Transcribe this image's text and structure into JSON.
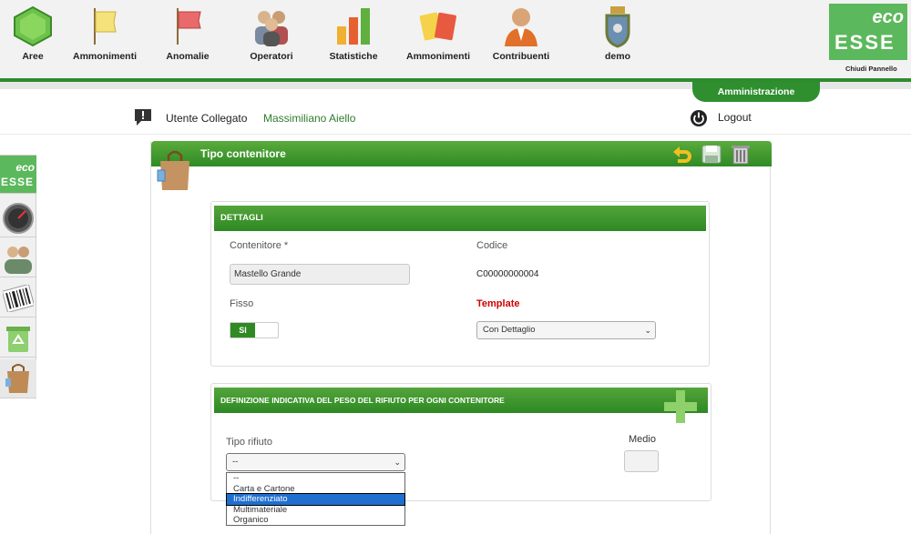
{
  "nav": [
    {
      "label": "Aree",
      "icon": "hexagon-icon"
    },
    {
      "label": "Ammonimenti",
      "icon": "yellow-flag-icon"
    },
    {
      "label": "Anomalie",
      "icon": "red-flag-icon"
    },
    {
      "label": "Operatori",
      "icon": "operators-icon"
    },
    {
      "label": "Statistiche",
      "icon": "bar-chart-icon"
    },
    {
      "label": "Ammonimenti",
      "icon": "cards-icon"
    },
    {
      "label": "Contribuenti",
      "icon": "user-icon"
    },
    {
      "label": "demo",
      "icon": "coat-of-arms-icon"
    }
  ],
  "logo": {
    "line1": "eco",
    "line2": "ESSE",
    "close_label": "Chiudi Pannello"
  },
  "admin_tab": "Amministrazione",
  "user": {
    "label": "Utente Collegato",
    "name": "Massimiliano Aiello",
    "logout": "Logout"
  },
  "page": {
    "title": "Tipo contenitore"
  },
  "details": {
    "header": "DETTAGLI",
    "contenitore_label": "Contenitore *",
    "contenitore_value": "Mastello Grande",
    "codice_label": "Codice",
    "codice_value": "C00000000004",
    "fisso_label": "Fisso",
    "fisso_value": "SI",
    "template_label": "Template",
    "template_value": "Con Dettaglio"
  },
  "weights": {
    "header": "DEFINIZIONE INDICATIVA DEL PESO DEL RIFIUTO PER OGNI CONTENITORE",
    "tipo_label": "Tipo rifiuto",
    "tipo_value": "--",
    "medio_label": "Medio",
    "options": [
      "--",
      "Carta e Cartone",
      "Indifferenziato",
      "Multimateriale",
      "Organico"
    ],
    "selected_option": "Indifferenziato"
  },
  "colors": {
    "green": "#2f8a24",
    "template_red": "#d00000"
  }
}
